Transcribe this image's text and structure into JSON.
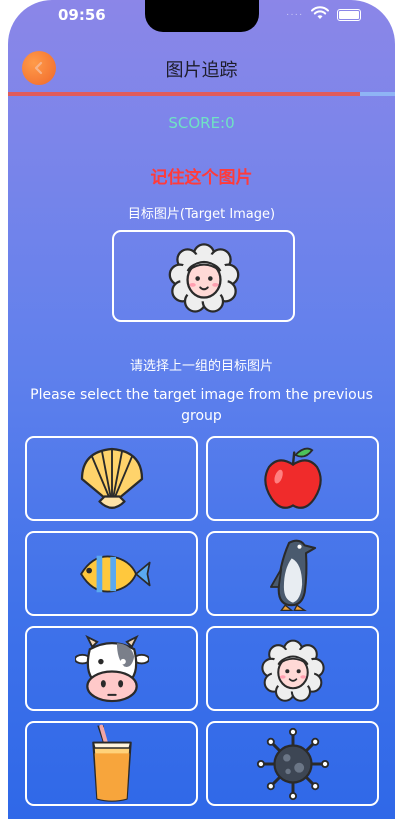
{
  "status_bar": {
    "time": "09:56",
    "signal_dots": "····"
  },
  "header": {
    "title": "图片追踪",
    "back_icon": "chevron-left-icon",
    "progress": 0.91
  },
  "score": {
    "text": "SCORE:0",
    "color": "#6fe3c4"
  },
  "instruction": {
    "remember": "记住这个图片",
    "color": "#ff3b3b"
  },
  "target": {
    "label": "目标图片(Target Image)",
    "icon": "sheep-icon"
  },
  "prompt": {
    "chinese": "请选择上一组的目标图片",
    "english": "Please select the target image from the previous group"
  },
  "options": [
    {
      "icon": "seashell-icon"
    },
    {
      "icon": "apple-icon"
    },
    {
      "icon": "fish-icon"
    },
    {
      "icon": "penguin-icon"
    },
    {
      "icon": "cow-icon"
    },
    {
      "icon": "sheep-icon"
    },
    {
      "icon": "juice-icon"
    },
    {
      "icon": "virus-icon"
    }
  ]
}
